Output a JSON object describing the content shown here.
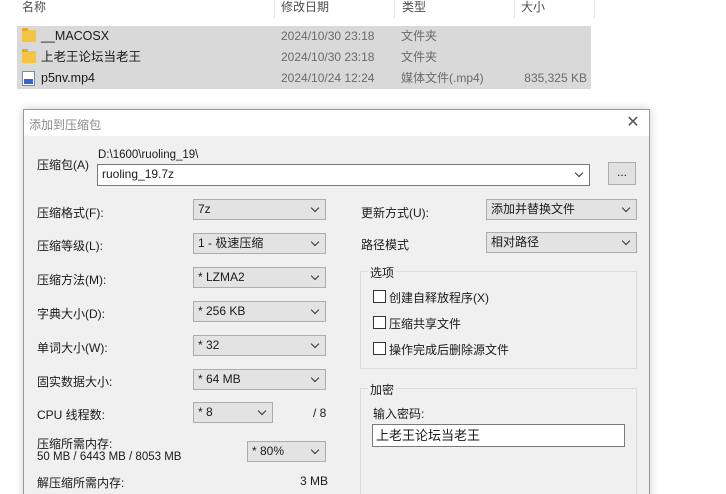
{
  "explorer": {
    "columns": {
      "name": "名称",
      "date": "修改日期",
      "type": "类型",
      "size": "大小"
    },
    "files": [
      {
        "name": "__MACOSX",
        "date": "2024/10/30 23:18",
        "type": "文件夹",
        "size": "",
        "icon": "folder-icon"
      },
      {
        "name": "上老王论坛当老王",
        "date": "2024/10/30 23:18",
        "type": "文件夹",
        "size": "",
        "icon": "folder-icon"
      },
      {
        "name": "p5nv.mp4",
        "date": "2024/10/24 12:24",
        "type": "媒体文件(.mp4)",
        "size": "835,325 KB",
        "icon": "video-file-icon"
      }
    ]
  },
  "dialog": {
    "title": "添加到压缩包",
    "archive_label": "压缩包(A)",
    "archive_path": "D:\\1600\\ruoling_19\\",
    "archive_name": "ruoling_19.7z",
    "browse_label": "...",
    "format_label": "压缩格式(F):",
    "format_value": "7z",
    "level_label": "压缩等级(L):",
    "level_value": "1 - 极速压缩",
    "method_label": "压缩方法(M):",
    "method_value": "* LZMA2",
    "dict_label": "字典大小(D):",
    "dict_value": "* 256 KB",
    "word_label": "单词大小(W):",
    "word_value": "* 32",
    "solid_label": "固实数据大小:",
    "solid_value": "* 64 MB",
    "threads_label": "CPU 线程数:",
    "threads_value": "* 8",
    "threads_total": "/ 8",
    "mem_label": "压缩所需内存:",
    "mem_detail": "50 MB / 6443 MB / 8053 MB",
    "mem_percent": "* 80%",
    "decomp_label": "解压缩所需内存:",
    "decomp_value": "3 MB",
    "update_label": "更新方式(U):",
    "update_value": "添加并替换文件",
    "path_label": "路径模式",
    "path_value": "相对路径",
    "options_title": "选项",
    "opt_sfx": "创建自释放程序(X)",
    "opt_shared": "压缩共享文件",
    "opt_delete": "操作完成后删除源文件",
    "encrypt_title": "加密",
    "password_label": "输入密码:",
    "password_value": "上老王论坛当老王",
    "close_symbol": "✕"
  }
}
